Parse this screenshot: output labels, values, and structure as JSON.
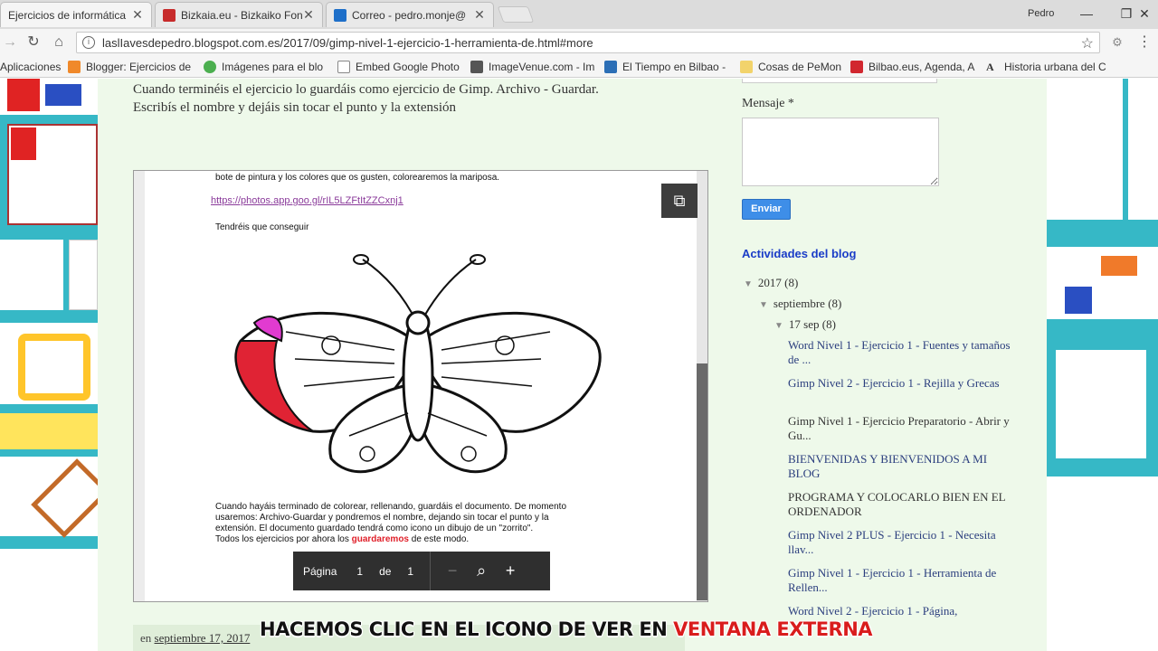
{
  "browser": {
    "tabs": [
      {
        "label": "Ejercicios de informática",
        "active": true
      },
      {
        "label": "Bizkaia.eu - Bizkaiko Fon",
        "active": false
      },
      {
        "label": "Correo - pedro.monje@",
        "active": false
      }
    ],
    "user_name": "Pedro",
    "url": "laslIavesdepedro.blogspot.com.es/2017/09/gimp-nivel-1-ejercicio-1-herramienta-de.html#more",
    "bookmarks": [
      "Aplicaciones",
      "Blogger: Ejercicios de",
      "Imágenes para el blo",
      "Embed Google Photo",
      "ImageVenue.com - Im",
      "El Tiempo en Bilbao -",
      "Cosas de PeMon",
      "Bilbao.eus, Agenda, A",
      "Historia urbana del C"
    ]
  },
  "post": {
    "intro_line1": "Cuando terminéis el ejercicio lo guardáis como ejercicio de Gimp. Archivo - Guardar.",
    "intro_line2": "Escribís el nombre y dejáis sin tocar el punto y la extensión",
    "viewer": {
      "doc_line1": "bote de pintura y los colores que os gusten, colorearemos la mariposa.",
      "doc_link": "https://photos.app.goo.gl/rIL5LZFtItZZCxnj1",
      "doc_line2": "Tendréis que conseguir",
      "doc_para1": "Cuando hayáis terminado de colorear, rellenando, guardáis el documento. De momento",
      "doc_para2": "usaremos: Archivo-Guardar y pondremos el nombre, dejando sin tocar el punto y la",
      "doc_para3": "extensión. El documento guardado tendrá como icono un  dibujo de un \"zorrito\".",
      "doc_para4_a": "Todos los ejercicios por ahora los ",
      "doc_para4_b": "guardaremos",
      "doc_para4_c": " de este modo.",
      "pager_label": "Página",
      "pager_current": "1",
      "pager_of": "de",
      "pager_total": "1"
    },
    "footer_prefix": "en ",
    "footer_date": "septiembre 17, 2017"
  },
  "sidebar": {
    "message_label": "Mensaje *",
    "send_label": "Enviar",
    "activity_title": "Actividades del blog",
    "archive_year": "2017 (8)",
    "archive_month": "septiembre (8)",
    "archive_day": "17 sep (8)",
    "posts": [
      "Word Nivel 1 - Ejercicio 1 - Fuentes y tamaños de ...",
      "Gimp Nivel 2 - Ejercicio 1 - Rejilla y Grecas",
      "Gimp Nivel 1 - Ejercicio Preparatorio - Abrir y Gu...",
      "BIENVENIDAS Y BIENVENIDOS A MI BLOG",
      "PROGRAMA Y COLOCARLO BIEN EN EL ORDENADOR",
      "Gimp Nivel 2 PLUS - Ejercicio 1 - Necesita llav...",
      "Gimp Nivel 1 - Ejercicio 1 - Herramienta de Rellen...",
      "Word Nivel 2 - Ejercicio 1 - Página,"
    ]
  },
  "subtitle": {
    "text": "HACEMOS CLIC EN EL ICONO DE VER EN ",
    "highlight": "VENTANA EXTERNA"
  }
}
